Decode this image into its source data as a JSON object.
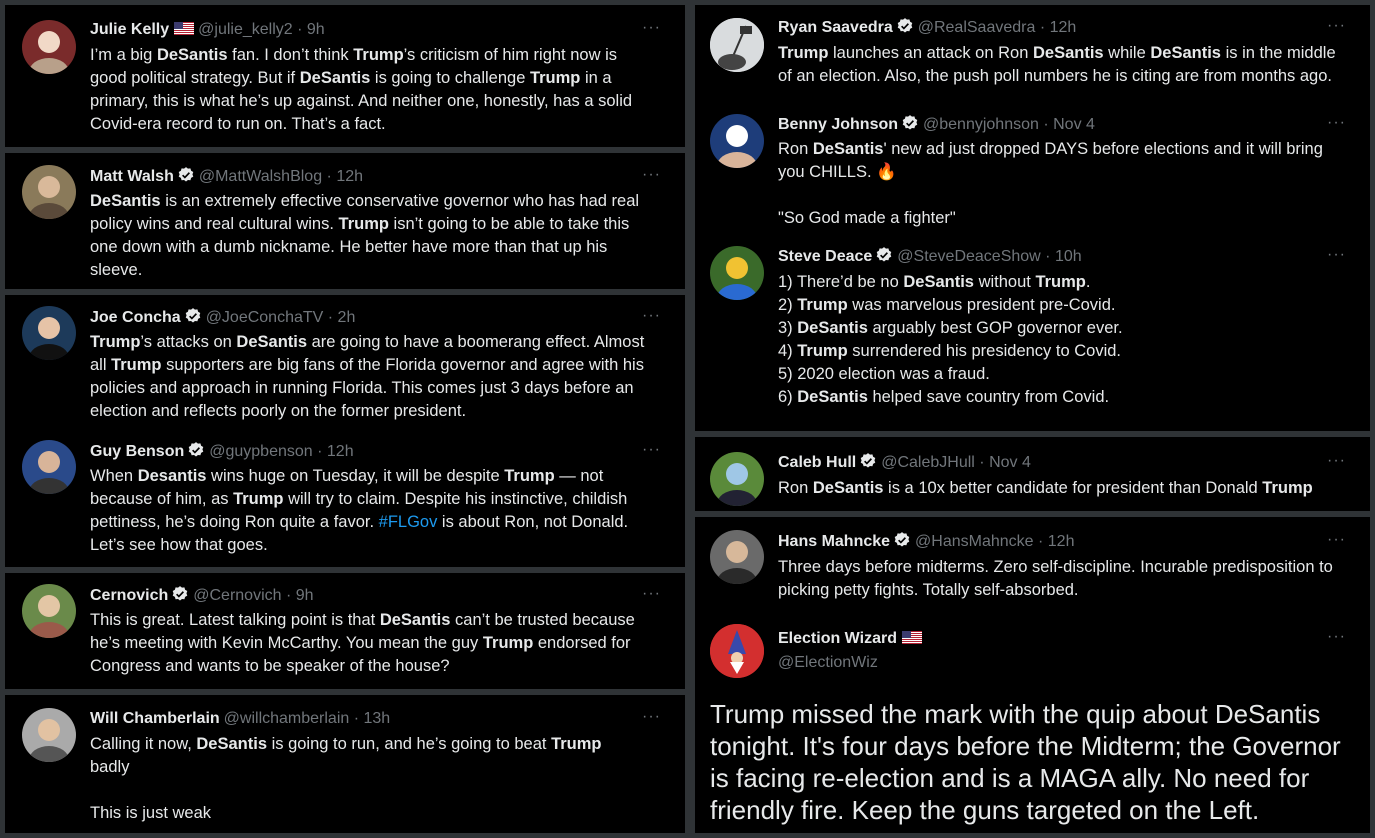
{
  "left_column": [
    {
      "name": "Julie Kelly",
      "flag": true,
      "handle": "@julie_kelly2",
      "time": "9h",
      "verified": false,
      "avatar_icon": "woman-portrait-icon",
      "lines": [
        [
          {
            "t": "I’m a big "
          },
          {
            "t": "DeSantis",
            "b": true
          },
          {
            "t": " fan. I don’t think "
          },
          {
            "t": "Trump",
            "b": true
          },
          {
            "t": "’s criticism of him right now is"
          }
        ],
        [
          {
            "t": "good political strategy. But if "
          },
          {
            "t": "DeSantis",
            "b": true
          },
          {
            "t": " is going to challenge "
          },
          {
            "t": "Trump",
            "b": true
          },
          {
            "t": " in a"
          }
        ],
        [
          {
            "t": "primary, this is what he’s up against. And neither one, honestly, has a solid"
          }
        ],
        [
          {
            "t": "Covid-era record to run on. That’s a fact."
          }
        ]
      ]
    },
    {
      "name": "Matt Walsh",
      "verified": true,
      "handle": "@MattWalshBlog",
      "time": "12h",
      "avatar_icon": "man-portrait-icon",
      "lines": [
        [
          {
            "t": "DeSantis",
            "b": true
          },
          {
            "t": " is an extremely effective conservative governor who has had real"
          }
        ],
        [
          {
            "t": "policy wins and real cultural wins. "
          },
          {
            "t": "Trump",
            "b": true
          },
          {
            "t": " isn’t going to be able to take this"
          }
        ],
        [
          {
            "t": "one down with a dumb nickname. He better have more than that up his"
          }
        ],
        [
          {
            "t": "sleeve."
          }
        ]
      ]
    },
    {
      "name": "Joe Concha",
      "verified": true,
      "handle": "@JoeConchaTV",
      "time": "2h",
      "avatar_icon": "man-suit-portrait-icon",
      "lines": [
        [
          {
            "t": "Trump",
            "b": true
          },
          {
            "t": "’s attacks on "
          },
          {
            "t": "DeSantis",
            "b": true
          },
          {
            "t": " are going to have a boomerang effect. Almost"
          }
        ],
        [
          {
            "t": "all "
          },
          {
            "t": "Trump",
            "b": true
          },
          {
            "t": " supporters are big fans of the Florida governor and agree with his"
          }
        ],
        [
          {
            "t": "policies and approach in running Florida. This comes just 3 days before an"
          }
        ],
        [
          {
            "t": "election and reflects poorly on the former president."
          }
        ]
      ]
    },
    {
      "name": "Guy Benson",
      "verified": true,
      "handle": "@guypbenson",
      "time": "12h",
      "avatar_icon": "man-studio-portrait-icon",
      "lines": [
        [
          {
            "t": "When "
          },
          {
            "t": "Desantis",
            "b": true
          },
          {
            "t": " wins huge on Tuesday, it will be despite "
          },
          {
            "t": "Trump",
            "b": true
          },
          {
            "t": " — not"
          }
        ],
        [
          {
            "t": "because of him, as "
          },
          {
            "t": "Trump",
            "b": true
          },
          {
            "t": " will try to claim. Despite his instinctive, childish"
          }
        ],
        [
          {
            "t": "pettiness, he’s doing Ron quite a favor. "
          },
          {
            "t": "#FLGov",
            "tag": true
          },
          {
            "t": " is about Ron, not Donald."
          }
        ],
        [
          {
            "t": "Let’s see how that goes."
          }
        ]
      ]
    },
    {
      "name": "Cernovich",
      "verified": true,
      "handle": "@Cernovich",
      "time": "9h",
      "avatar_icon": "family-photo-icon",
      "lines": [
        [
          {
            "t": "This is great. Latest talking point is that "
          },
          {
            "t": "DeSantis",
            "b": true
          },
          {
            "t": " can’t be trusted because"
          }
        ],
        [
          {
            "t": "he’s meeting with Kevin McCarthy. You mean the guy "
          },
          {
            "t": "Trump",
            "b": true
          },
          {
            "t": " endorsed for"
          }
        ],
        [
          {
            "t": "Congress and wants to be speaker of the house?"
          }
        ]
      ]
    },
    {
      "name": "Will Chamberlain",
      "verified": false,
      "handle": "@willchamberlain",
      "time": "13h",
      "avatar_icon": "man-with-baby-portrait-icon",
      "lines": [
        [
          {
            "t": "Calling it now, "
          },
          {
            "t": "DeSantis",
            "b": true
          },
          {
            "t": " is going to run, and he’s going to beat "
          },
          {
            "t": "Trump",
            "b": true
          }
        ],
        [
          {
            "t": "badly"
          }
        ],
        [
          {
            "t": ""
          }
        ],
        [
          {
            "t": "This is just weak"
          }
        ]
      ]
    }
  ],
  "right_column": [
    {
      "name": "Ryan Saavedra",
      "verified": true,
      "handle": "@RealSaavedra",
      "time": "12h",
      "avatar_icon": "flag-raising-icon",
      "lines": [
        [
          {
            "t": "Trump",
            "b": true
          },
          {
            "t": " launches an attack on Ron "
          },
          {
            "t": "DeSantis",
            "b": true
          },
          {
            "t": " while "
          },
          {
            "t": "DeSantis",
            "b": true
          },
          {
            "t": " is in the middle"
          }
        ],
        [
          {
            "t": "of an election. Also, the push poll numbers he is citing are from months ago."
          }
        ]
      ]
    },
    {
      "name": "Benny Johnson",
      "verified": true,
      "handle": "@bennyjohnson",
      "time": "Nov 4",
      "avatar_icon": "man-portrait-icon",
      "lines": [
        [
          {
            "t": "Ron "
          },
          {
            "t": "DeSantis",
            "b": true
          },
          {
            "t": "' new ad just dropped DAYS before elections and it will bring"
          }
        ],
        [
          {
            "t": "you CHILLS. 🔥"
          }
        ],
        [
          {
            "t": ""
          }
        ],
        [
          {
            "t": "\"So God made a fighter\""
          }
        ]
      ]
    },
    {
      "name": "Steve Deace",
      "verified": true,
      "handle": "@SteveDeaceShow",
      "time": "10h",
      "avatar_icon": "cartoon-avatar-icon",
      "lines": [
        [
          {
            "t": "1) There’d be no "
          },
          {
            "t": "DeSantis",
            "b": true
          },
          {
            "t": " without "
          },
          {
            "t": "Trump",
            "b": true
          },
          {
            "t": "."
          }
        ],
        [
          {
            "t": "2) "
          },
          {
            "t": "Trump",
            "b": true
          },
          {
            "t": " was marvelous president pre-Covid."
          }
        ],
        [
          {
            "t": "3) "
          },
          {
            "t": "DeSantis",
            "b": true
          },
          {
            "t": " arguably best GOP governor ever."
          }
        ],
        [
          {
            "t": "4) "
          },
          {
            "t": "Trump",
            "b": true
          },
          {
            "t": " surrendered his presidency to Covid."
          }
        ],
        [
          {
            "t": "5) 2020 election was a fraud."
          }
        ],
        [
          {
            "t": "6) "
          },
          {
            "t": "DeSantis",
            "b": true
          },
          {
            "t": " helped save country from Covid."
          }
        ]
      ]
    },
    {
      "name": "Caleb Hull",
      "verified": true,
      "handle": "@CalebJHull",
      "time": "Nov 4",
      "avatar_icon": "golfer-photo-icon",
      "lines": [
        [
          {
            "t": "Ron "
          },
          {
            "t": "DeSantis",
            "b": true
          },
          {
            "t": " is a 10x better candidate for president than Donald "
          },
          {
            "t": "Trump",
            "b": true
          }
        ]
      ]
    },
    {
      "name": "Hans Mahncke",
      "verified": true,
      "handle": "@HansMahncke",
      "time": "12h",
      "avatar_icon": "man-portrait-icon",
      "lines": [
        [
          {
            "t": "Three days before midterms. Zero self-discipline. Incurable predisposition to"
          }
        ],
        [
          {
            "t": "picking petty fights. Totally self-absorbed."
          }
        ]
      ]
    },
    {
      "name": "Election Wizard",
      "flag": true,
      "verified": false,
      "handle": "@ElectionWiz",
      "time": "",
      "avatar_icon": "wizard-icon",
      "lines": [
        [
          {
            "t": "Trump missed the mark with the quip about DeSantis"
          }
        ],
        [
          {
            "t": "tonight. It's four days before the Midterm; the Governor"
          }
        ],
        [
          {
            "t": "is facing re-election and is a MAGA ally. No need for"
          }
        ],
        [
          {
            "t": "friendly fire. Keep the guns targeted on the Left."
          }
        ]
      ]
    }
  ],
  "colors": {
    "background": "#000000",
    "text": "#e7e9ea",
    "muted": "#71767b",
    "hashtag": "#1d9bf0",
    "verified": "#e7e9ea"
  },
  "more_label": "···"
}
